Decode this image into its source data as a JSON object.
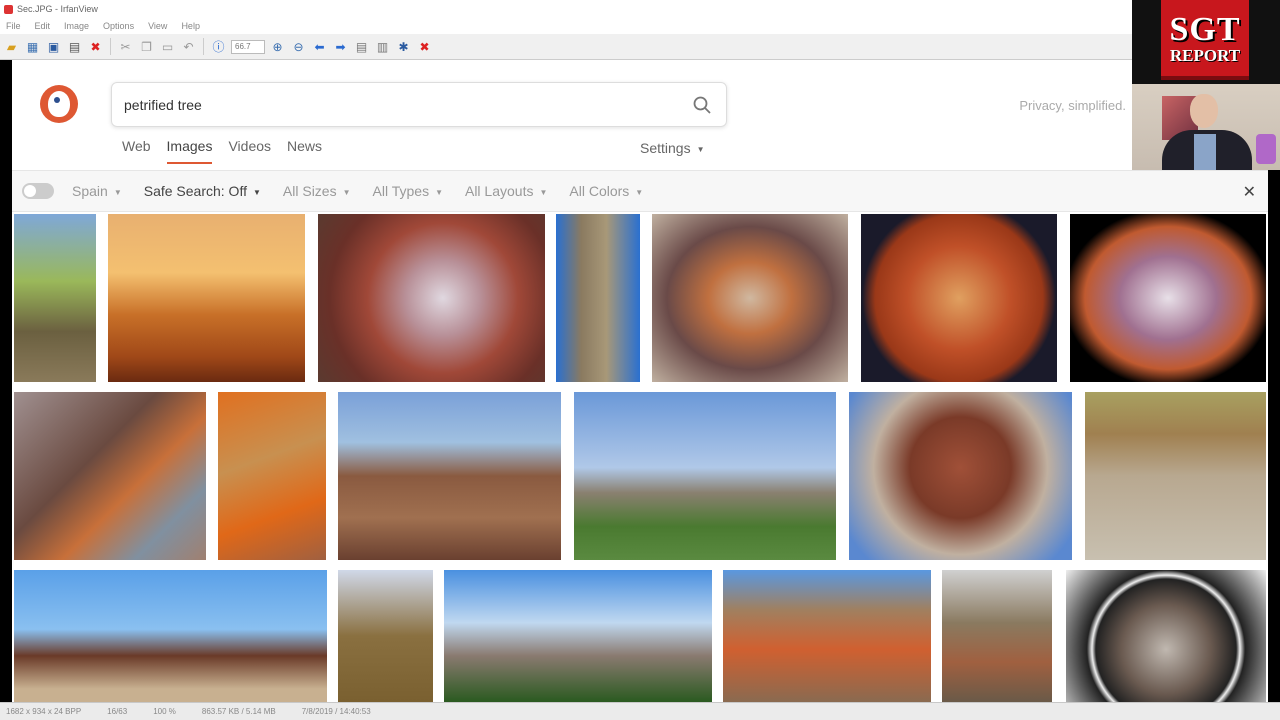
{
  "viewer": {
    "title": "Sec.JPG - IrfanView",
    "menu": [
      "File",
      "Edit",
      "Image",
      "Options",
      "View",
      "Help"
    ],
    "zoom": "66.7",
    "status": [
      "1682 x 934 x 24 BPP",
      "16/63",
      "100 %",
      "863.57 KB / 5.14 MB",
      "7/8/2019 / 14:40:53"
    ]
  },
  "overlay": {
    "logo_line1": "SGT",
    "logo_line2": "REPORT"
  },
  "search": {
    "query": "petrified tree",
    "privacy": "Privacy, simplified.",
    "tabs": [
      "Web",
      "Images",
      "Videos",
      "News"
    ],
    "active_tab": "Images",
    "settings": "Settings"
  },
  "filters": {
    "region": "Spain",
    "safe_search": "Safe Search: Off",
    "sizes": "All Sizes",
    "types": "All Types",
    "layouts": "All Layouts",
    "colors": "All Colors"
  }
}
